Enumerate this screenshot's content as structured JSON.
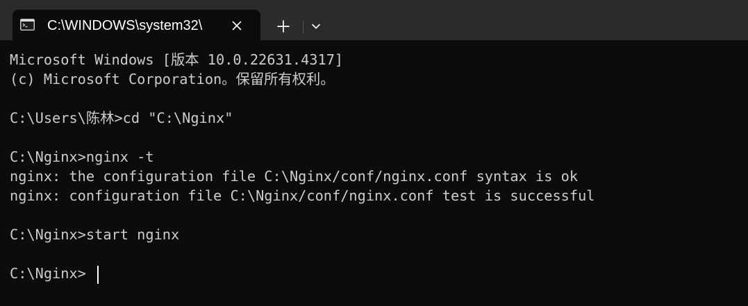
{
  "window": {
    "tab_title": "C:\\WINDOWS\\system32\\",
    "tab_icon": "terminal-icon",
    "close_icon": "close-icon",
    "new_tab_icon": "plus-icon",
    "dropdown_icon": "chevron-down-icon"
  },
  "colors": {
    "background": "#0c0c0c",
    "titlebar": "#2b2b2b",
    "text": "#cccccc"
  },
  "terminal": {
    "lines": [
      "Microsoft Windows [版本 10.0.22631.4317]",
      "(c) Microsoft Corporation。保留所有权利。",
      "",
      "C:\\Users\\陈林>cd \"C:\\Nginx\"",
      "",
      "C:\\Nginx>nginx -t",
      "nginx: the configuration file C:\\Nginx/conf/nginx.conf syntax is ok",
      "nginx: configuration file C:\\Nginx/conf/nginx.conf test is successful",
      "",
      "C:\\Nginx>start nginx",
      "",
      "C:\\Nginx>"
    ]
  }
}
